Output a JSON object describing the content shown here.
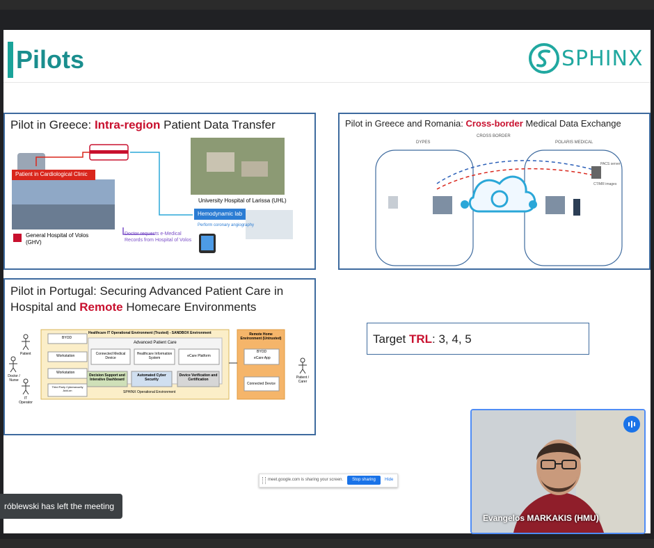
{
  "slide": {
    "title": "Pilots",
    "logo_text": "SPHINX",
    "pilot_greece": {
      "title_pre": "Pilot in Greece: ",
      "title_hl": "Intra-region",
      "title_post": " Patient Data Transfer",
      "patient_label": "Patient in Cardiological Clinic",
      "uhl_label": "University Hospital of Larissa (UHL)",
      "hemo_label": "Hemodynamic lab",
      "angio_label": "Perform coronary angiography",
      "ghv_label_1": "General Hospital of Volos",
      "ghv_label_2": "(GHV)",
      "doctor_label_1": "Doctor requests e-Medical",
      "doctor_label_2": "Records from Hospital of Volos"
    },
    "pilot_romania": {
      "title_pre": "Pilot in Greece and Romania: ",
      "title_hl": "Cross-border",
      "title_post": " Medical Data Exchange",
      "left_label": "DYPES",
      "center_label": "CROSS BORDER",
      "right_label": "POLARIS MEDICAL",
      "pacs_label": "PACS server",
      "images_label": "CT/MR images"
    },
    "pilot_portugal": {
      "title_line1_pre": "Pilot in Portugal: Securing Advanced Patient Care in",
      "title_line2_pre": "Hospital and ",
      "title_hl": "Remote",
      "title_line2_post": " Homecare Environments",
      "env_title": "Healthcare IT Operational Environment (Trusted) - SANDBOX Environment",
      "adv_care": "Advanced Patient Care",
      "connected_med": "Connected Medical Device",
      "his": "Healthcare Information System",
      "ecare": "eCare Platform",
      "decision": "Decision Support and Interative Dashboard",
      "cyber": "Automated Cyber Security",
      "device_verif": "Device Verification and Certification",
      "sphinx_env": "SPHINX Operational Environment",
      "byod": "BYOD",
      "workstation1": "Workstation",
      "workstation2": "Workstation",
      "thirdparty": "Third Party Cybersecurity Add-on",
      "remote_title": "Remote Home Environment (Untrusted)",
      "remote_byod": "BYOD",
      "ecare_app": "eCare App",
      "connected_device": "Connected Device",
      "actor_patient": "Patient",
      "actor_doctor": "Doctor / Nurse",
      "actor_it": "IT Operator",
      "actor_patient_carer": "Patient / Carer"
    },
    "trl": {
      "pre": "Target ",
      "hl": "TRL",
      "post": ": 3, 4, 5"
    }
  },
  "share_bar": {
    "text": "meet.google.com is sharing your screen.",
    "stop_label": "Stop sharing",
    "hide_label": "Hide"
  },
  "toast": {
    "text": "róblewski has left the meeting"
  },
  "video": {
    "participant_name": "Evangelos MARKAKIS (HMU)"
  }
}
